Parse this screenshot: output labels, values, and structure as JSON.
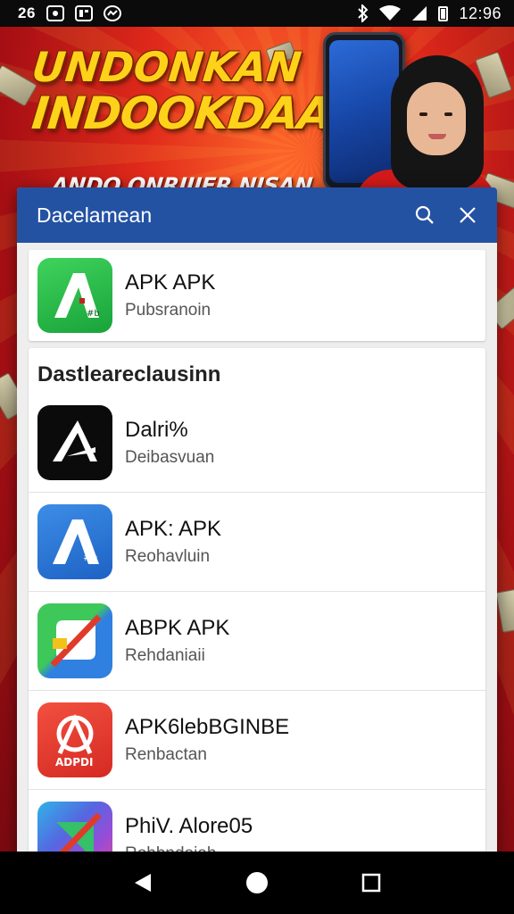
{
  "status_bar": {
    "left_time": "26",
    "clock": "12:96",
    "left_icons": [
      "gallery-notification-icon",
      "news-notification-icon",
      "messenger-notification-icon"
    ],
    "right_icons": [
      "bluetooth-icon",
      "wifi-icon",
      "cellular-signal-icon",
      "battery-icon"
    ]
  },
  "banner": {
    "headline_line1": "UNDONKAN",
    "headline_line2": "INDOOKDAA",
    "subline": "ANDO ONRIIJER NISAN",
    "colors": {
      "headline": "#ffd21a",
      "background": "#e02a1b"
    }
  },
  "dialog": {
    "title": "Dacelamean",
    "header_color": "#2452a3",
    "search_icon": "search-icon",
    "close_icon": "close-icon",
    "featured": {
      "name": "APK APK",
      "subtitle": "Pubsranoin",
      "icon": "green-apk-icon"
    },
    "section_title": "Dastleareclausinn",
    "apps": [
      {
        "name": "Dalri%",
        "subtitle": "Deibasvuan",
        "icon": "black-triangle-icon"
      },
      {
        "name": "APK: APK",
        "subtitle": "Reohavluin",
        "icon": "blue-apk-icon"
      },
      {
        "name": "ABPK APK",
        "subtitle": "Rehdaniaii",
        "icon": "multicolor-apk-icon"
      },
      {
        "name": "APK6lebBGINBE",
        "subtitle": "Renbactan",
        "icon": "red-apk-icon"
      },
      {
        "name": "PhiV. Alore05",
        "subtitle": "Rohbndoiah",
        "icon": "purple-apk-icon"
      }
    ]
  },
  "nav_bar": {
    "back_icon": "back-icon",
    "home_icon": "home-icon",
    "recents_icon": "recents-icon"
  }
}
